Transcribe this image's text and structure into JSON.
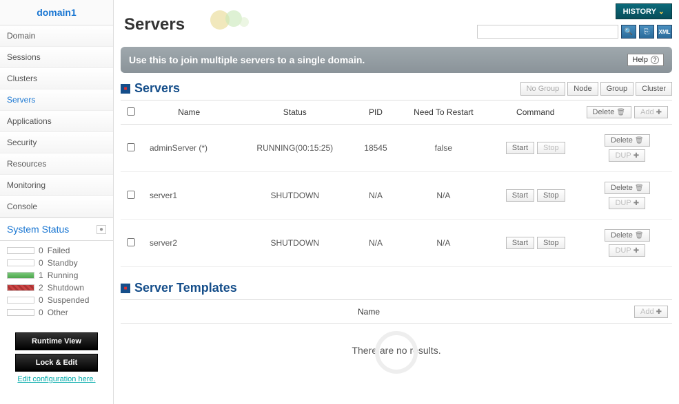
{
  "domain_name": "domain1",
  "sidebar": {
    "items": [
      {
        "label": "Domain"
      },
      {
        "label": "Sessions"
      },
      {
        "label": "Clusters"
      },
      {
        "label": "Servers",
        "active": true
      },
      {
        "label": "Applications"
      },
      {
        "label": "Security"
      },
      {
        "label": "Resources"
      },
      {
        "label": "Monitoring"
      },
      {
        "label": "Console"
      }
    ],
    "system_status_label": "System Status",
    "status": [
      {
        "count": "0",
        "label": "Failed"
      },
      {
        "count": "0",
        "label": "Standby"
      },
      {
        "count": "1",
        "label": "Running",
        "color": "green"
      },
      {
        "count": "2",
        "label": "Shutdown",
        "color": "red-stripe"
      },
      {
        "count": "0",
        "label": "Suspended"
      },
      {
        "count": "0",
        "label": "Other"
      }
    ],
    "runtime_view": "Runtime View",
    "lock_edit": "Lock & Edit",
    "edit_config": "Edit configuration here."
  },
  "page_title": "Servers",
  "history_label": "HISTORY",
  "banner_text": "Use this to join multiple servers to a single domain.",
  "help_label": "Help",
  "servers_section": {
    "title": "Servers",
    "group_buttons": {
      "no_group": "No Group",
      "node": "Node",
      "group": "Group",
      "cluster": "Cluster"
    },
    "columns": {
      "name": "Name",
      "status": "Status",
      "pid": "PID",
      "restart": "Need To Restart",
      "command": "Command"
    },
    "header_actions": {
      "delete": "Delete",
      "add": "Add"
    },
    "row_buttons": {
      "start": "Start",
      "stop": "Stop",
      "delete": "Delete",
      "dup": "DUP"
    },
    "rows": [
      {
        "name": "adminServer (*)",
        "status": "RUNNING(00:15:25)",
        "pid": "18545",
        "restart": "false",
        "stop_disabled": true
      },
      {
        "name": "server1",
        "status": "SHUTDOWN",
        "pid": "N/A",
        "restart": "N/A",
        "stop_disabled": false
      },
      {
        "name": "server2",
        "status": "SHUTDOWN",
        "pid": "N/A",
        "restart": "N/A",
        "stop_disabled": false
      }
    ]
  },
  "templates_section": {
    "title": "Server Templates",
    "name_col": "Name",
    "add": "Add",
    "no_results": "There are no results."
  }
}
